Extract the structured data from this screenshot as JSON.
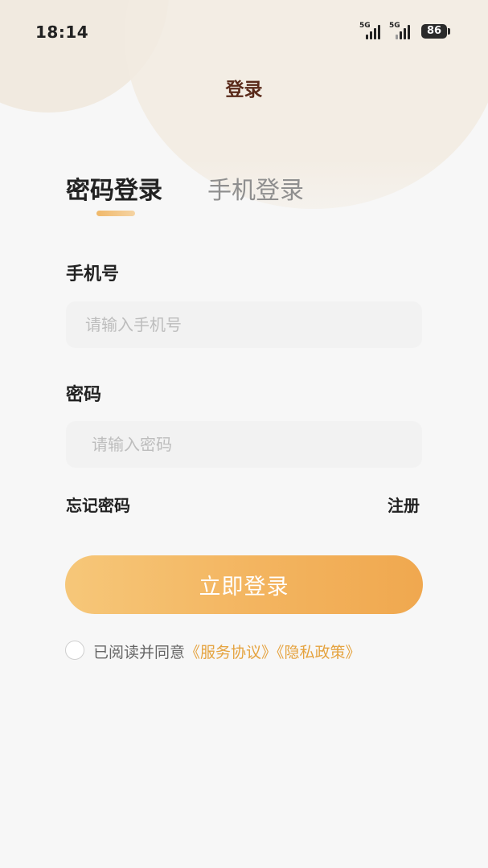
{
  "status_bar": {
    "time": "18:14",
    "signal1_label": "5G",
    "signal2_label": "5G",
    "battery": "86"
  },
  "nav": {
    "title": "登录"
  },
  "tabs": [
    {
      "label": "密码登录",
      "active": true
    },
    {
      "label": "手机登录",
      "active": false
    }
  ],
  "form": {
    "phone_label": "手机号",
    "phone_placeholder": "请输入手机号",
    "password_label": "密码",
    "password_placeholder": "请输入密码"
  },
  "links": {
    "forgot": "忘记密码",
    "register": "注册"
  },
  "login_button": "立即登录",
  "agreement": {
    "prefix": "已阅读并同意",
    "terms": "《服务协议》",
    "privacy": "《隐私政策》",
    "checked": false
  },
  "colors": {
    "accent": "#f3b45f",
    "link": "#e5a33f",
    "title": "#5a2a1a"
  }
}
